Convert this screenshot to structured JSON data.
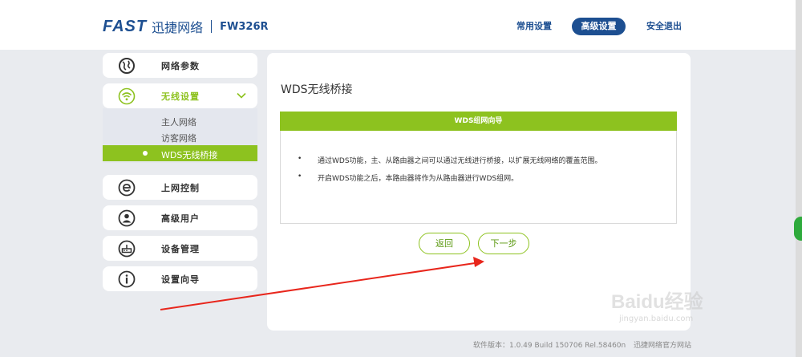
{
  "header": {
    "logo": "FAST",
    "brand_cn": "迅捷网络",
    "model": "FW326R",
    "nav": {
      "common": "常用设置",
      "advanced": "高级设置",
      "logout": "安全退出"
    }
  },
  "sidebar": {
    "items": [
      {
        "label": "网络参数",
        "icon": "globe-icon"
      },
      {
        "label": "无线设置",
        "icon": "wifi-icon"
      },
      {
        "label": "上网控制",
        "icon": "e-icon"
      },
      {
        "label": "高级用户",
        "icon": "user-icon"
      },
      {
        "label": "设备管理",
        "icon": "router-icon"
      },
      {
        "label": "设置向导",
        "icon": "info-icon"
      }
    ],
    "submenu": [
      "主人网络",
      "访客网络",
      "WDS无线桥接"
    ]
  },
  "main": {
    "title": "WDS无线桥接",
    "wizard_title": "WDS组网向导",
    "bullets": [
      "通过WDS功能，主、从路由器之间可以通过无线进行桥接，以扩展无线网络的覆盖范围。",
      "开启WDS功能之后，本路由器将作为从路由器进行WDS组网。"
    ],
    "back_label": "返回",
    "next_label": "下一步"
  },
  "footer": {
    "version": "软件版本：1.0.49 Build 150706 Rel.58460n",
    "site": "迅捷网络官方网站"
  },
  "watermark": {
    "logo": "Baidu经验",
    "url": "jingyan.baidu.com"
  },
  "colors": {
    "accent_green": "#8dc21f",
    "brand_blue": "#1d4f91",
    "annotation_arrow": "#e8261c"
  }
}
